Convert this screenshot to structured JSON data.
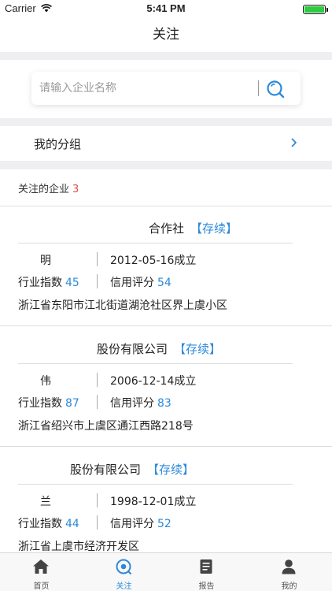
{
  "status_bar": {
    "carrier": "Carrier",
    "time": "5:41 PM"
  },
  "nav": {
    "title": "关注"
  },
  "search": {
    "placeholder": "请输入企业名称"
  },
  "group": {
    "label": "我的分组"
  },
  "follow": {
    "label": "关注的企业",
    "count": "3"
  },
  "companies": [
    {
      "name": "合作社",
      "status": "【存续】",
      "person": "明",
      "founded": "2012-05-16成立",
      "industry_label": "行业指数",
      "industry": "45",
      "credit_label": "信用评分",
      "credit": "54",
      "address": "浙江省东阳市江北街道湖沧社区界上虞小区"
    },
    {
      "name": "股份有限公司",
      "status": "【存续】",
      "person": "伟",
      "founded": "2006-12-14成立",
      "industry_label": "行业指数",
      "industry": "87",
      "credit_label": "信用评分",
      "credit": "83",
      "address": "浙江省绍兴市上虞区通江西路218号"
    },
    {
      "name": "股份有限公司",
      "status": "【存续】",
      "person": "兰",
      "founded": "1998-12-01成立",
      "industry_label": "行业指数",
      "industry": "44",
      "credit_label": "信用评分",
      "credit": "52",
      "address": "浙江省上虞市经济开发区"
    }
  ],
  "tabs": [
    {
      "label": "首页",
      "icon": "home-icon"
    },
    {
      "label": "关注",
      "icon": "follow-eye-icon"
    },
    {
      "label": "报告",
      "icon": "report-icon"
    },
    {
      "label": "我的",
      "icon": "profile-icon"
    }
  ],
  "colors": {
    "accent": "#2d8ad9",
    "count": "#e34c4c",
    "divider_bg": "#efeff2"
  }
}
